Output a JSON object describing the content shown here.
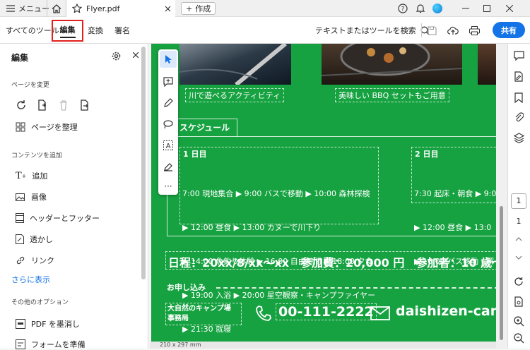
{
  "titlebar": {
    "menu_label": "メニュー",
    "tab_title": "Flyer.pdf",
    "create_label": "作成"
  },
  "toolbar": {
    "tabs": [
      "すべてのツール",
      "編集",
      "変換",
      "署名"
    ],
    "search_label": "テキストまたはツールを検索",
    "share_label": "共有",
    "accent": "#1473e6",
    "highlight": "#e0211d"
  },
  "panel": {
    "title": "編集",
    "section_page": "ページを変更",
    "organize_label": "ページを整理",
    "section_content": "コンテンツを追加",
    "items": [
      "追加",
      "画像",
      "ヘッダーとフッター",
      "透かし",
      "リンク"
    ],
    "more_label": "さらに表示",
    "section_other": "その他のオプション",
    "other_items": [
      "PDF を墨消し",
      "フォームを準備"
    ]
  },
  "document": {
    "bg_color": "#17a241",
    "caption_left": "川で遊べるアクティビティ",
    "caption_right": "美味しい BBQ セットもご用意",
    "schedule_title": "スケジュール",
    "day1_title": "1 日目",
    "day1_lines": [
      "7:00 現地集合 ▶ 9:00 バスで移動 ▶ 10:00 森林探検",
      "▶ 12:00 昼食 ▶ 13:00 カヌーで川下り",
      "▶ 14:00 魚釣り体験 ▶ 16:00 自由時間 ▶ 18:00 夕食",
      "▶ 19:00 入浴 ▶ 20:00 星空観察・キャンプファイヤー",
      "▶ 21:30 就寝"
    ],
    "day2_title": "2 日目",
    "day2_lines": [
      "7:30 起床・朝食 ▶ 9:0",
      "▶ 12:00 昼食 ▶ 13:0",
      "▶ 16:00 バス移動・解"
    ],
    "info_line": "日程：20xx/8/xx〜xx　参加費：20,000 円　参加者：10 歳〜",
    "apply_label": "お申し込み",
    "org_name": "大自然のキャンプ場\n事務局",
    "phone": "00-111-2222",
    "email": "daishizen-cam"
  },
  "footer": {
    "page_size": "210 x 297 mm"
  },
  "pagenav": {
    "current": "1",
    "total": "1"
  }
}
